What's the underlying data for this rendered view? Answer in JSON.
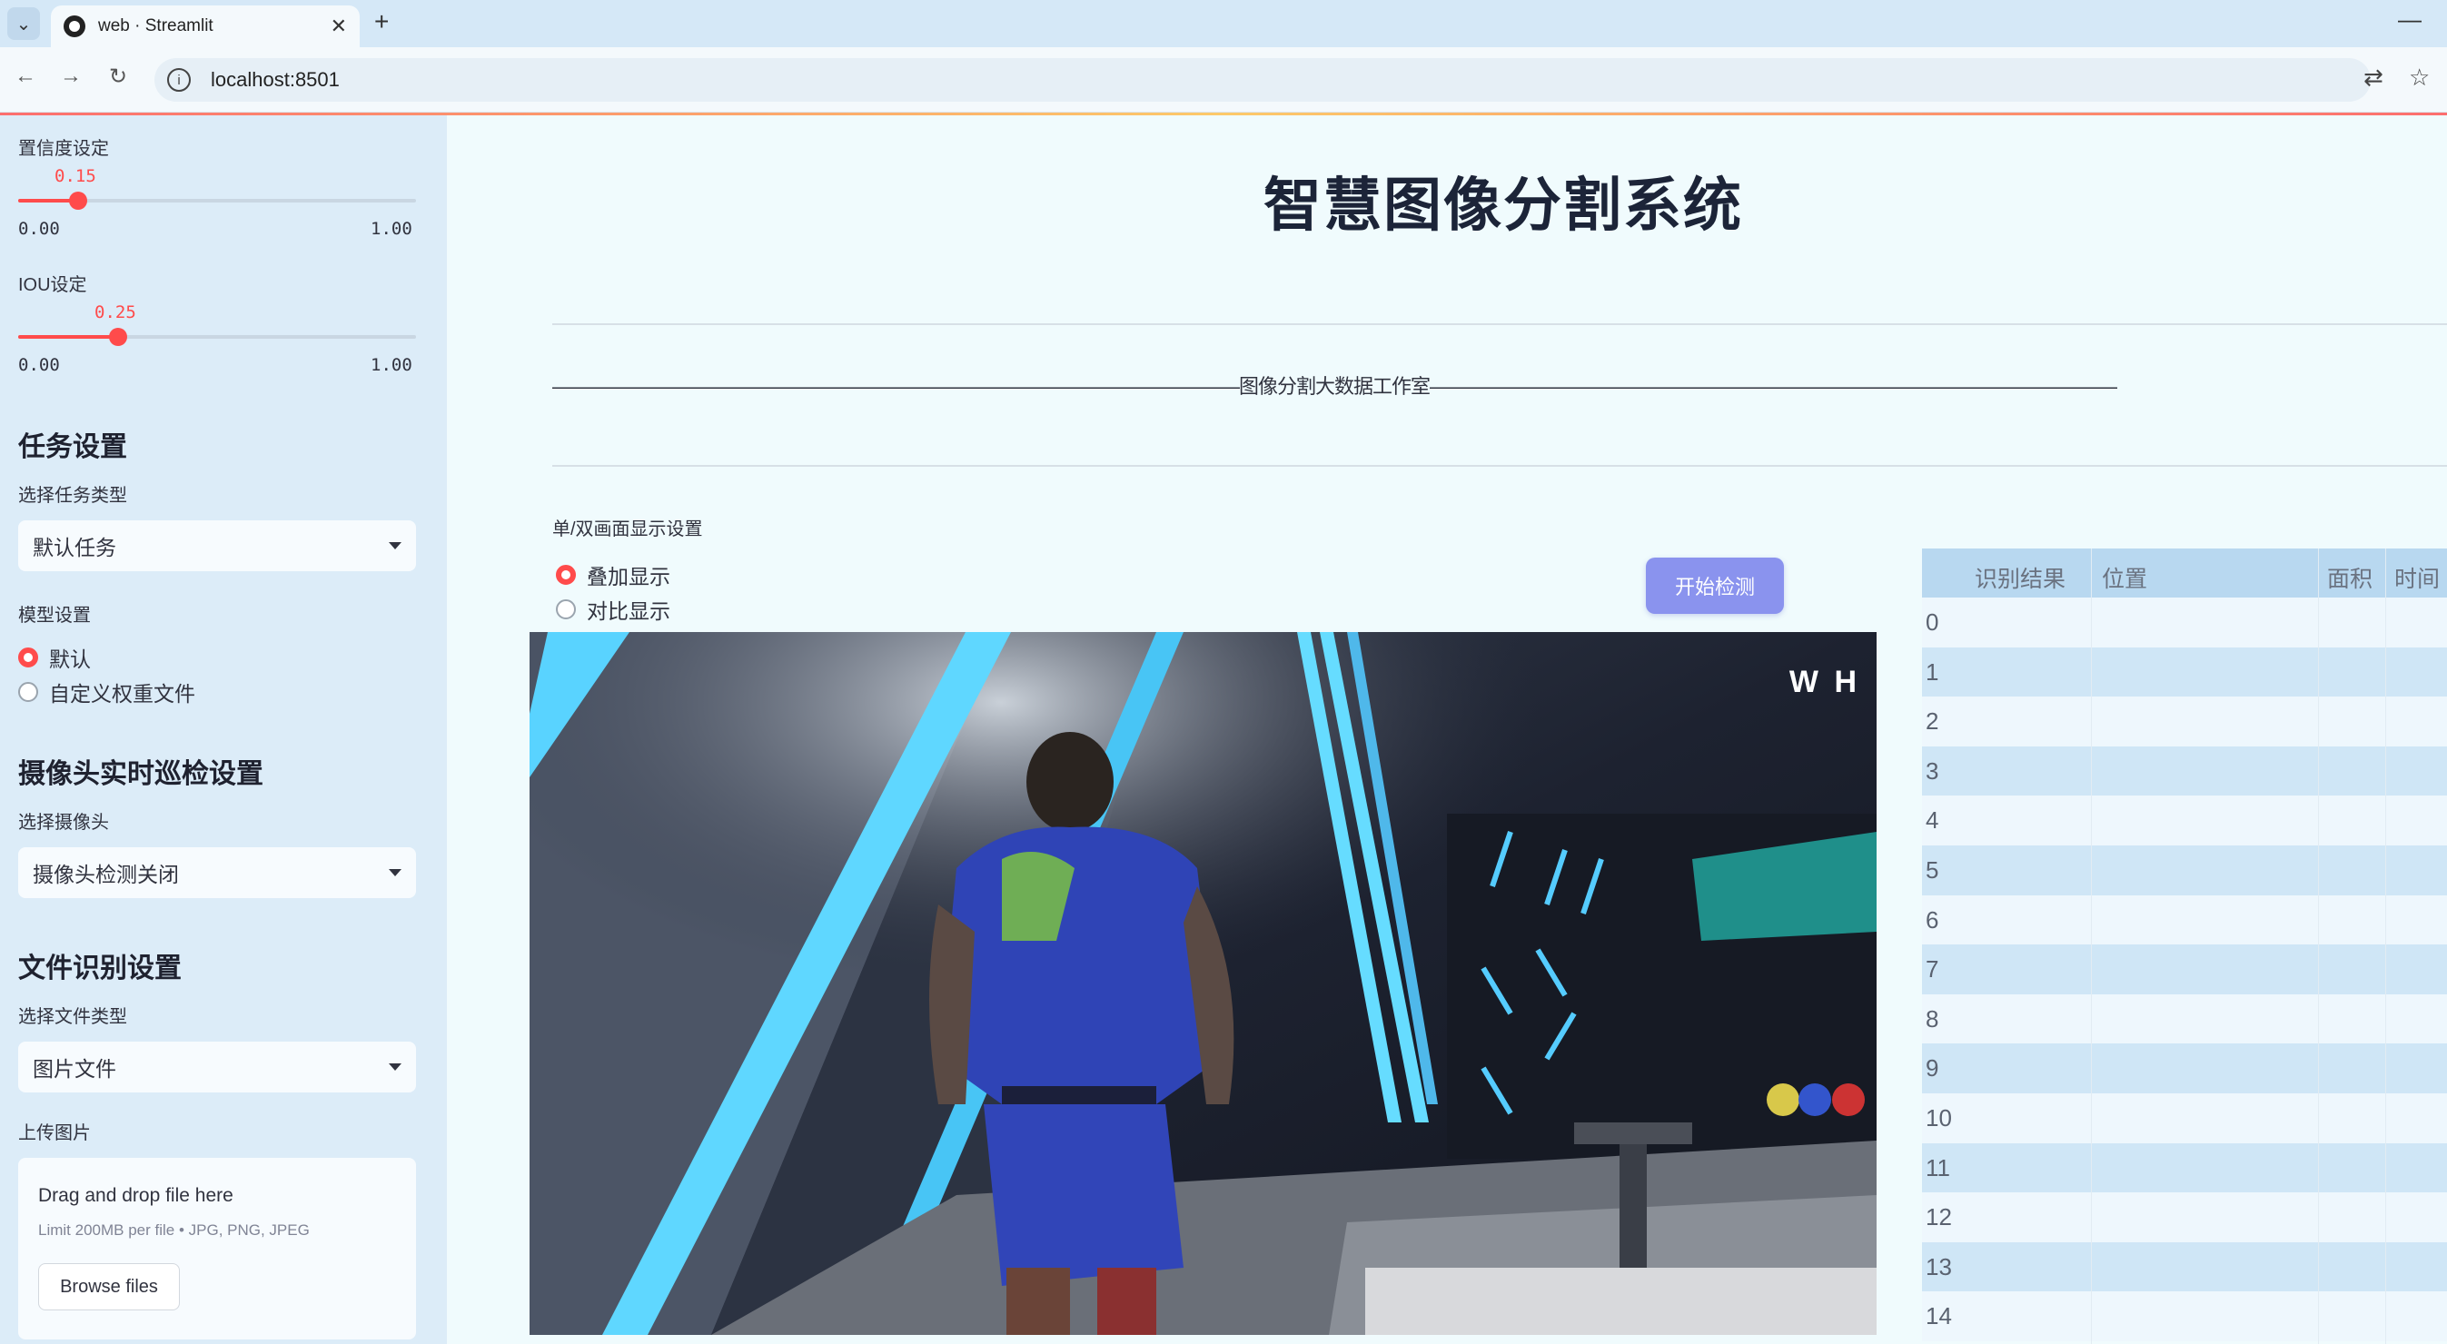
{
  "browser": {
    "tab_title": "web · Streamlit",
    "url": "localhost:8501"
  },
  "sidebar": {
    "confidence": {
      "label": "置信度设定",
      "value": "0.15",
      "min": "0.00",
      "max": "1.00",
      "fraction": 0.15
    },
    "iou": {
      "label": "IOU设定",
      "value": "0.25",
      "min": "0.00",
      "max": "1.00",
      "fraction": 0.25
    },
    "task_heading": "任务设置",
    "task_type_label": "选择任务类型",
    "task_type_value": "默认任务",
    "model_label": "模型设置",
    "model_options": [
      "默认",
      "自定义权重文件"
    ],
    "model_selected": "默认",
    "camera_heading": "摄像头实时巡检设置",
    "camera_label": "选择摄像头",
    "camera_value": "摄像头检测关闭",
    "file_heading": "文件识别设置",
    "file_type_label": "选择文件类型",
    "file_type_value": "图片文件",
    "upload_label": "上传图片",
    "uploader": {
      "main": "Drag and drop file here",
      "sub": "Limit 200MB per file • JPG, PNG, JPEG",
      "button": "Browse files"
    }
  },
  "main": {
    "title": "智慧图像分割系统",
    "divider_text": "————————————————————————————————————图像分割大数据工作室————————————————————————————————————",
    "display_label": "单/双画面显示设置",
    "display_options": [
      "叠加显示",
      "对比显示"
    ],
    "display_selected": "叠加显示",
    "start_button": "开始检测",
    "image_watermark": "W H"
  },
  "table": {
    "columns": [
      "识别结果",
      "位置",
      "面积",
      "时间"
    ],
    "row_index": [
      "0",
      "1",
      "2",
      "3",
      "4",
      "5",
      "6",
      "7",
      "8",
      "9",
      "10",
      "11",
      "12",
      "13",
      "14"
    ]
  },
  "colors": {
    "accent": "#ff4b4b",
    "button": "#8a93ee",
    "sidebar_bg": "#dcecf8",
    "main_bg": "#f0fbfd"
  }
}
